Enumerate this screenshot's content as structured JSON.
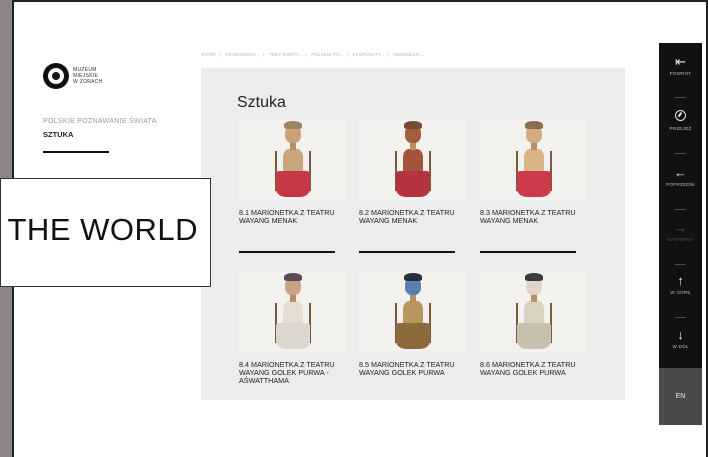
{
  "museum": {
    "logo_lines": [
      "MUZEUM",
      "MIEJSKIE",
      "W ŻORACH"
    ]
  },
  "section": {
    "subtitle": "POLSKIE POZNAWANIE ŚWIATA",
    "title": "SZTUKA"
  },
  "breadcrumb": [
    "START",
    "STANOWISKA...",
    "TRZY KONTY...",
    "POLSKIE PO...",
    "EKSPONATY...",
    "INDONEZJA..."
  ],
  "panel": {
    "title": "Sztuka",
    "items": [
      {
        "label": "8.1 MARIONETKA Z TEATRU WAYANG MENAK",
        "color": "#c63846"
      },
      {
        "label": "8.2 MARIONETKA Z TEATRU WAYANG MENAK",
        "color": "#b43340"
      },
      {
        "label": "8.3 MARIONETKA Z TEATRU WAYANG MENAK",
        "color": "#cc3a4c"
      },
      {
        "label": "8.4 MARIONETKA Z TEATRU WAYANG GOLEK PURWA - AŚWATTHAMA",
        "color": "#ddd6cc"
      },
      {
        "label": "8.5 MARIONETKA Z TEATRU WAYANG GOLEK PURWA",
        "color": "#5a7fb0"
      },
      {
        "label": "8.6 MARIONETKA Z TEATRU WAYANG GOLEK PURWA",
        "color": "#d9d2c2"
      }
    ]
  },
  "nav": {
    "back": "POWRÓT",
    "go": "PRZEJDŹ",
    "previous": "POPRZEDNI",
    "next": "NASTĘPNY",
    "up": "W GÓRĘ",
    "down": "W DÓŁ",
    "language": "EN"
  },
  "overlay": {
    "text": "THE WORLD"
  }
}
